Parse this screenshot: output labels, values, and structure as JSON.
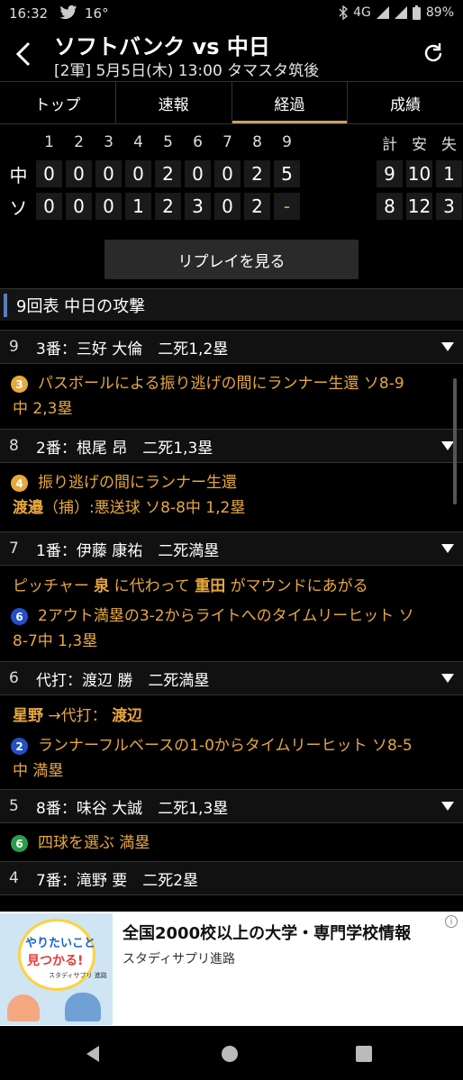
{
  "status_bar": {
    "time": "16:32",
    "temperature": "16°",
    "network": "4G",
    "battery": "89%"
  },
  "header": {
    "title": "ソフトバンク vs 中日",
    "subtitle": "[2軍] 5月5日(木) 13:00 タマスタ筑後"
  },
  "tabs": [
    {
      "label": "トップ",
      "active": false
    },
    {
      "label": "速報",
      "active": false
    },
    {
      "label": "経過",
      "active": true
    },
    {
      "label": "成績",
      "active": false
    }
  ],
  "scoreboard": {
    "innings": [
      "1",
      "2",
      "3",
      "4",
      "5",
      "6",
      "7",
      "8",
      "9"
    ],
    "totals_headers": [
      "計",
      "安",
      "失"
    ],
    "teams": [
      {
        "name": "中",
        "scores": [
          "0",
          "0",
          "0",
          "0",
          "2",
          "0",
          "0",
          "2",
          "5"
        ],
        "totals": [
          "9",
          "10",
          "1"
        ]
      },
      {
        "name": "ソ",
        "scores": [
          "0",
          "0",
          "0",
          "1",
          "2",
          "3",
          "0",
          "2",
          "-"
        ],
        "totals": [
          "8",
          "12",
          "3"
        ]
      }
    ]
  },
  "replay_button": "リプレイを見る",
  "section_title": "9回表 中日の攻撃",
  "plays": [
    {
      "num": "9",
      "batter": "3番：三好 大倫　二死1,2塁"
    },
    {
      "badge": "3",
      "line1": "パスボールによる振り逃げの間にランナー生還 ソ8-9",
      "line2": "中 2,3塁"
    },
    {
      "num": "8",
      "batter": "2番：根尾 昂　二死1,3塁"
    },
    {
      "badge": "4",
      "line1": "振り逃げの間にランナー生還",
      "line2_name": "渡邉",
      "line2_rest": "（捕）:悪送球 ソ8-8中 1,2塁"
    },
    {
      "num": "7",
      "batter": "1番：伊藤 康祐　二死満塁"
    },
    {
      "p_a": "ピッチャー",
      "p_b": "泉",
      "p_c": "に代わって",
      "p_d": "重田",
      "p_e": "がマウンドにあがる"
    },
    {
      "badge": "6",
      "line1": "2アウト満塁の3-2からライトへのタイムリーヒット ソ",
      "line2": "8-7中 1,3塁"
    },
    {
      "num": "6",
      "batter": "代打：渡辺 勝　二死満塁"
    },
    {
      "s_a": "星野",
      "s_b": "→代打：",
      "s_c": "渡辺"
    },
    {
      "badge": "2",
      "line1": "ランナーフルベースの1-0からタイムリーヒット ソ8-5",
      "line2": "中 満塁"
    },
    {
      "num": "5",
      "batter": "8番：味谷 大誠　二死1,3塁"
    },
    {
      "badge": "6",
      "line1": "四球を選ぶ 満塁"
    },
    {
      "num": "4",
      "batter": "7番：滝野 要　二死2塁"
    }
  ],
  "ad": {
    "headline": "全国2000校以上の大学・専門学校情報",
    "sponsor": "スタディサプリ進路",
    "image_text_1": "やりたいこと",
    "image_text_2": "見つかる!",
    "image_text_3": "スタディサプリ 進路"
  },
  "colors": {
    "accent": "#c9a25e",
    "event": "#e8a83c",
    "change": "#3cb85a"
  }
}
